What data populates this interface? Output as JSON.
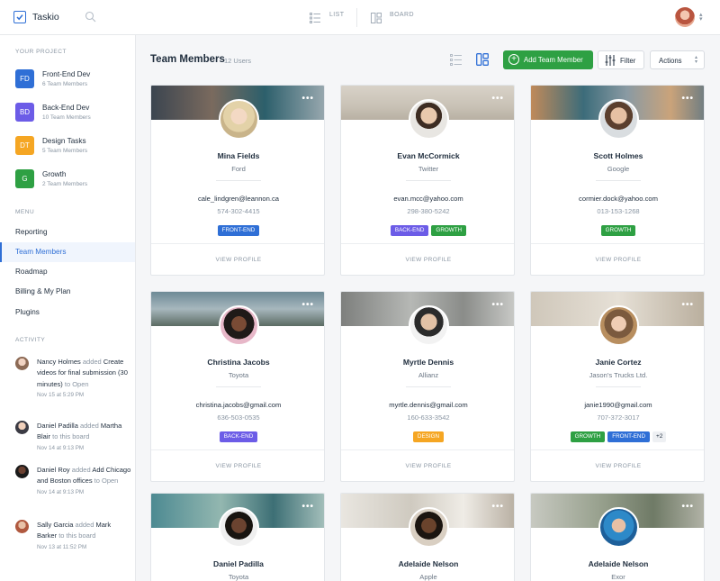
{
  "app": {
    "name": "Taskio"
  },
  "topbar": {
    "list_label": "LIST",
    "board_label": "BOARD"
  },
  "sidebar": {
    "project_title": "YOUR PROJECT",
    "projects": [
      {
        "abbr": "FD",
        "name": "Front-End Dev",
        "sub": "6 Team Members",
        "color": "#2f6fd6"
      },
      {
        "abbr": "BD",
        "name": "Back-End Dev",
        "sub": "10 Team Members",
        "color": "#6c5ce7"
      },
      {
        "abbr": "DT",
        "name": "Design Tasks",
        "sub": "5 Team Members",
        "color": "#f5a623"
      },
      {
        "abbr": "G",
        "name": "Growth",
        "sub": "2 Team Members",
        "color": "#2ea043"
      }
    ],
    "menu_title": "MENU",
    "menu": [
      "Reporting",
      "Team Members",
      "Roadmap",
      "Billing & My Plan",
      "Plugins"
    ],
    "activity_title": "ACTIVITY",
    "activity": [
      {
        "user": "Nancy Holmes",
        "verb": "added",
        "item": "Create videos for final submission (30 minutes)",
        "target": "to Open",
        "time": "Nov 15 at 5:29 PM"
      },
      {
        "user": "Daniel Padilla",
        "verb": "added",
        "item": "Martha Blair",
        "target": "to this board",
        "time": "Nov 14 at 9:13 PM"
      },
      {
        "user": "Daniel Roy",
        "verb": "added",
        "item": "Add Chicago and Boston offices",
        "target": "to Open",
        "time": "Nov 14 at 9:13 PM"
      },
      {
        "user": "Sally Garcia",
        "verb": "added",
        "item": "Mark Barker",
        "target": "to this board",
        "time": "Nov 13 at 11:52 PM"
      }
    ]
  },
  "main": {
    "title": "Team Members",
    "count": "12 Users",
    "add_button": "Add Team Member",
    "filter_button": "Filter",
    "actions_button": "Actions",
    "view_profile": "VIEW PROFILE",
    "more": "•••"
  },
  "members": [
    {
      "name": "Mina Fields",
      "company": "Ford",
      "email": "cale_lindgren@leannon.ca",
      "phone": "574-302-4415",
      "tags": [
        "FRONT-END"
      ],
      "more": ""
    },
    {
      "name": "Evan McCormick",
      "company": "Twitter",
      "email": "evan.mcc@yahoo.com",
      "phone": "298-380-5242",
      "tags": [
        "BACK-END",
        "GROWTH"
      ],
      "more": ""
    },
    {
      "name": "Scott Holmes",
      "company": "Google",
      "email": "cormier.dock@yahoo.com",
      "phone": "013-153-1268",
      "tags": [
        "GROWTH"
      ],
      "more": ""
    },
    {
      "name": "Christina Jacobs",
      "company": "Toyota",
      "email": "christina.jacobs@gmail.com",
      "phone": "636-503-0535",
      "tags": [
        "BACK-END"
      ],
      "more": ""
    },
    {
      "name": "Myrtle Dennis",
      "company": "Allianz",
      "email": "myrtle.dennis@gmail.com",
      "phone": "160-633-3542",
      "tags": [
        "DESIGN"
      ],
      "more": ""
    },
    {
      "name": "Janie Cortez",
      "company": "Jason's Trucks Ltd.",
      "email": "janie1990@gmail.com",
      "phone": "707-372-3017",
      "tags": [
        "GROWTH",
        "FRONT-END"
      ],
      "more": "+2"
    },
    {
      "name": "Daniel Padilla",
      "company": "Toyota",
      "email": "",
      "phone": "",
      "tags": [],
      "more": ""
    },
    {
      "name": "Adelaide Nelson",
      "company": "Apple",
      "email": "",
      "phone": "",
      "tags": [],
      "more": ""
    },
    {
      "name": "Adelaide Nelson",
      "company": "Exor",
      "email": "",
      "phone": "",
      "tags": [],
      "more": ""
    }
  ],
  "tag_colors": {
    "FRONT-END": "#2f6fd6",
    "BACK-END": "#6c5ce7",
    "GROWTH": "#2ea043",
    "DESIGN": "#f5a623"
  }
}
